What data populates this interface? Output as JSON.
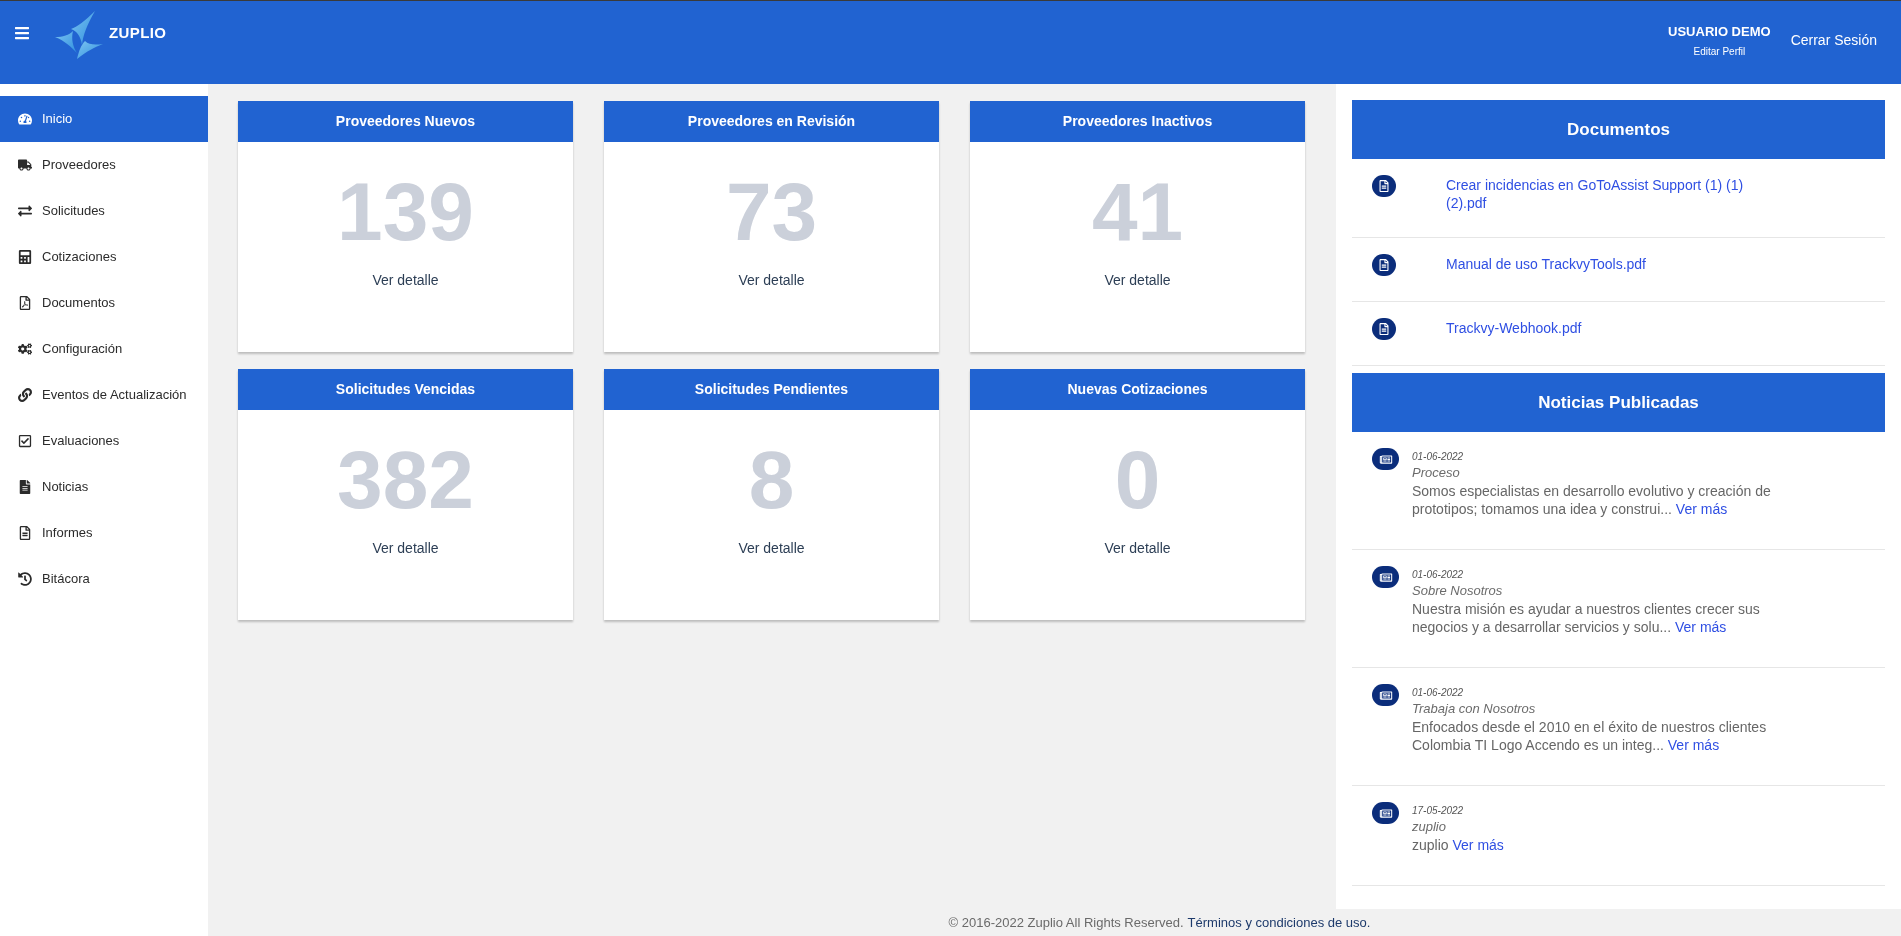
{
  "header": {
    "brand": "ZUPLIO",
    "user_name": "USUARIO DEMO",
    "profile_link": "Editar Perfil",
    "logout": "Cerrar Sesión"
  },
  "sidebar": {
    "items": [
      {
        "label": "Inicio",
        "selected": true
      },
      {
        "label": "Proveedores",
        "selected": false
      },
      {
        "label": "Solicitudes",
        "selected": false
      },
      {
        "label": "Cotizaciones",
        "selected": false
      },
      {
        "label": "Documentos",
        "selected": false
      },
      {
        "label": "Configuración",
        "selected": false
      },
      {
        "label": "Eventos de Actualización",
        "selected": false
      },
      {
        "label": "Evaluaciones",
        "selected": false
      },
      {
        "label": "Noticias",
        "selected": false
      },
      {
        "label": "Informes",
        "selected": false
      },
      {
        "label": "Bitácora",
        "selected": false
      }
    ]
  },
  "stat_cards": [
    {
      "title": "Proveedores Nuevos",
      "count": "139",
      "link": "Ver detalle"
    },
    {
      "title": "Proveedores en Revisión",
      "count": "73",
      "link": "Ver detalle"
    },
    {
      "title": "Proveedores Inactivos",
      "count": "41",
      "link": "Ver detalle"
    },
    {
      "title": "Solicitudes Vencidas",
      "count": "382",
      "link": "Ver detalle"
    },
    {
      "title": "Solicitudes Pendientes",
      "count": "8",
      "link": "Ver detalle"
    },
    {
      "title": "Nuevas Cotizaciones",
      "count": "0",
      "link": "Ver detalle"
    }
  ],
  "documents": {
    "title": "Documentos",
    "items": [
      {
        "name": "Crear incidencias en GoToAssist Support (1) (1) (2).pdf"
      },
      {
        "name": "Manual de uso TrackvyTools.pdf"
      },
      {
        "name": "Trackvy-Webhook.pdf"
      }
    ]
  },
  "news": {
    "title": "Noticias Publicadas",
    "items": [
      {
        "date": "01-06-2022",
        "title": "Proceso",
        "excerpt": "Somos especialistas en desarrollo evolutivo y creación de prototipos; tomamos una idea y construi...",
        "link": "Ver más"
      },
      {
        "date": "01-06-2022",
        "title": "Sobre Nosotros",
        "excerpt": "Nuestra misión es ayudar a nuestros clientes crecer sus negocios y a desarrollar servicios y solu...",
        "link": "Ver más"
      },
      {
        "date": "01-06-2022",
        "title": "Trabaja con Nosotros",
        "excerpt": "Enfocados desde el 2010 en el éxito de nuestros clientes Colombia TI Logo Accendo es un integ...",
        "link": "Ver más"
      },
      {
        "date": "17-05-2022",
        "title": "zuplio",
        "excerpt": "zuplio",
        "link": "Ver más"
      }
    ]
  },
  "footer": {
    "copyright": "© 2016-2022 Zuplio All Rights Reserved.",
    "terms_link": "Términos y condiciones de uso."
  }
}
